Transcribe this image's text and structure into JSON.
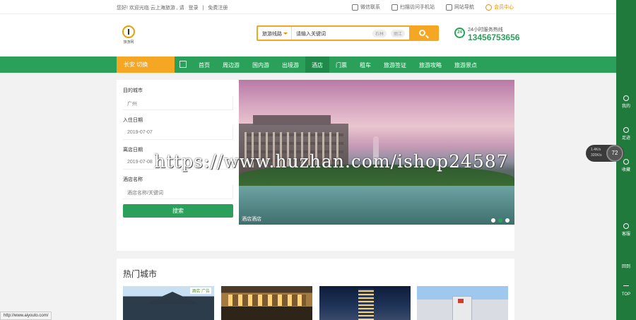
{
  "topbar": {
    "greeting": "您好! 欢迎光临 云上海旅游 , 请",
    "login": "登录",
    "sep": "|",
    "register": "免费注册",
    "links": [
      {
        "label": "微信联系",
        "icon": "wechat-icon"
      },
      {
        "label": "扫描访问手机站",
        "icon": "mobile-icon"
      },
      {
        "label": "网站导航",
        "icon": "sitemap-icon"
      },
      {
        "label": "会员中心",
        "icon": "user-center-icon"
      }
    ]
  },
  "header": {
    "logo_text": "旅游网",
    "search": {
      "category": "旅游线路",
      "placeholder": "请输入关键词",
      "tags": [
        "石林",
        "丽江"
      ]
    },
    "hotline": {
      "badge": "24",
      "label": "24小时服务热线",
      "number": "13456753656"
    }
  },
  "nav": {
    "city": "长安 切换",
    "items": [
      "首页",
      "周边游",
      "国内游",
      "出境游",
      "酒店",
      "门票",
      "租车",
      "旅游签证",
      "旅游攻略",
      "旅游景点"
    ],
    "active_index": 4
  },
  "booking": {
    "city_label": "目的城市",
    "city_value": "广州",
    "checkin_label": "入住日期",
    "checkin_value": "2019-07-07",
    "checkout_label": "离店日期",
    "checkout_value": "2019-07-08",
    "hotel_label": "酒店名称",
    "hotel_placeholder": "酒店名称/关键词",
    "search_button": "搜索"
  },
  "banner": {
    "caption": "酒店酒店",
    "slides": 3,
    "active_slide": 2
  },
  "hot_cities": {
    "title": "热门城市",
    "ad_text": "酒店 广告"
  },
  "watermark": "https://www.huzhan.com/ishop24587",
  "status_url": "http://www.aiyouto.com/",
  "sidebar": {
    "items": [
      "我的",
      "足迹",
      "收藏",
      "客服",
      "回到",
      "TOP"
    ]
  },
  "speed": {
    "up": "1.4K/s",
    "down": "320K/s",
    "percent": "72"
  },
  "colors": {
    "primary_green": "#2aa05a",
    "accent_orange": "#f5a623",
    "sidebar_green": "#1f7a3c"
  }
}
